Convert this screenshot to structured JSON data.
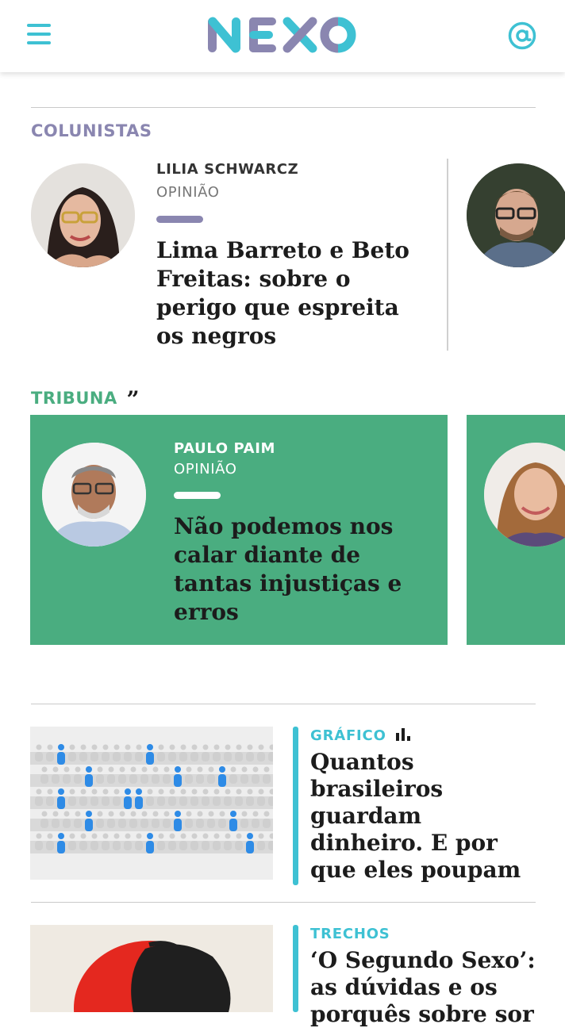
{
  "header": {
    "logo_text": "NEXO",
    "menu_icon": "hamburger-menu-icon",
    "account_icon": "at-sign-icon",
    "brand_color": "#3ec1d3"
  },
  "colunistas": {
    "section_label": "COLUNISTAS",
    "cards": [
      {
        "author": "LILIA SCHWARCZ",
        "kind": "OPINIÃO",
        "headline": [
          "Lima Barreto e Beto",
          "Freitas: sobre o",
          "perigo que espreita",
          "os negros"
        ]
      }
    ],
    "label_color": "#8a86b0"
  },
  "tribuna": {
    "section_label": "TRIBUNA",
    "quote_mark": "”",
    "cards": [
      {
        "author": "PAULO PAIM",
        "kind": "OPINIÃO",
        "headline": [
          "Não podemos nos",
          "calar diante de",
          "tantas injustiças e",
          "erros"
        ]
      }
    ],
    "card_color": "#4aad80"
  },
  "stories": [
    {
      "tag": "GRÁFICO",
      "tag_icon": "bar-chart-icon",
      "title": [
        "Quantos",
        "brasileiros",
        "guardam",
        "dinheiro. E por",
        "que eles poupam"
      ]
    },
    {
      "tag": "TRECHOS",
      "title": [
        "‘O Segundo Sexo’:",
        "as dúvidas e os",
        "porquês sobre sor"
      ]
    }
  ]
}
